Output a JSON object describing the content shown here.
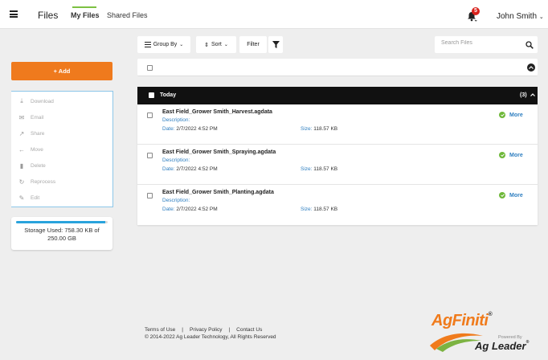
{
  "header": {
    "app_title": "Files",
    "tabs": [
      {
        "label": "My Files",
        "active": true
      },
      {
        "label": "Shared Files",
        "active": false
      }
    ],
    "notification_count": "5",
    "user_name": "John Smith"
  },
  "toolbar": {
    "group_by_label": "Group By",
    "sort_label": "Sort",
    "filter_label": "Filter",
    "search_placeholder": "Search Files"
  },
  "sidebar": {
    "add_label": "+ Add",
    "actions": [
      {
        "label": "Download",
        "icon": "download-icon"
      },
      {
        "label": "Email",
        "icon": "email-icon"
      },
      {
        "label": "Share",
        "icon": "share-icon"
      },
      {
        "label": "Move",
        "icon": "move-icon"
      },
      {
        "label": "Delete",
        "icon": "delete-icon"
      },
      {
        "label": "Reprocess",
        "icon": "reprocess-icon"
      },
      {
        "label": "Edit",
        "icon": "edit-icon"
      }
    ],
    "storage": {
      "label": "Storage Used: 758.30 KB of 250.00 GB",
      "used_fraction": 0.97
    }
  },
  "files": {
    "group_title": "Today",
    "group_count": "(3)",
    "items": [
      {
        "name": "East Field_Grower Smith_Harvest.agdata",
        "description_label": "Description:",
        "date_label": "Date:",
        "date": "2/7/2022 4:52 PM",
        "size_label": "Size:",
        "size": "118.57 KB",
        "more_label": "More"
      },
      {
        "name": "East Field_Grower Smith_Spraying.agdata",
        "description_label": "Description:",
        "date_label": "Date:",
        "date": "2/7/2022 4:52 PM",
        "size_label": "Size:",
        "size": "118.57 KB",
        "more_label": "More"
      },
      {
        "name": "East Field_Grower Smith_Planting.agdata",
        "description_label": "Description:",
        "date_label": "Date:",
        "date": "2/7/2022 4:52 PM",
        "size_label": "Size:",
        "size": "118.57 KB",
        "more_label": "More"
      }
    ]
  },
  "footer": {
    "terms": "Terms of Use",
    "privacy": "Privacy Policy",
    "contact": "Contact Us",
    "copyright": "© 2014-2022 Ag Leader Technology, All Rights Reserved"
  },
  "logo": {
    "brand": "AgFiniti",
    "powered_by": "Powered By",
    "company": "Ag Leader"
  },
  "colors": {
    "accent_orange": "#ef7a1d",
    "link_blue": "#2f7fc1",
    "success_green": "#6fb83a",
    "storage_blue": "#29a3dc",
    "badge_red": "#d9221c"
  }
}
